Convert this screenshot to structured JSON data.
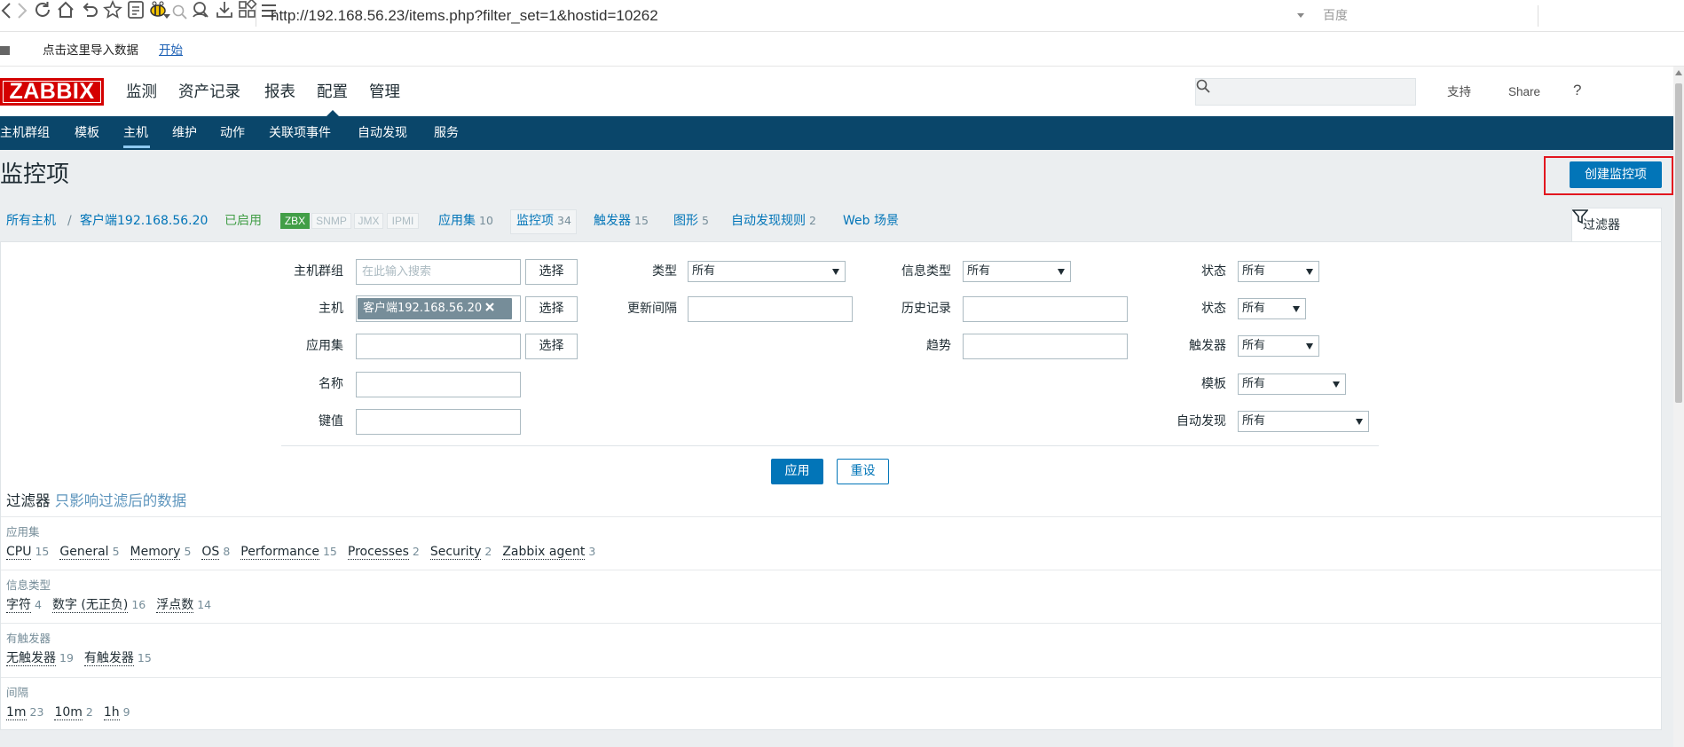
{
  "browser": {
    "url": "http://192.168.56.23/items.php?filter_set=1&hostid=10262",
    "search_engine": "百度"
  },
  "bookmarks": {
    "import_text": "点击这里导入数据",
    "start_link": "开始"
  },
  "header": {
    "logo": "ZABBIX",
    "nav": [
      {
        "label": "监测"
      },
      {
        "label": "资产记录"
      },
      {
        "label": "报表"
      },
      {
        "label": "配置",
        "active": true
      },
      {
        "label": "管理"
      }
    ],
    "support": "支持",
    "share": "Share",
    "help": "?"
  },
  "subnav": {
    "items": [
      "主机群组",
      "模板",
      "主机",
      "维护",
      "动作",
      "关联项事件",
      "自动发现",
      "服务"
    ],
    "active": "主机"
  },
  "page": {
    "title": "监控项",
    "create_button": "创建监控项"
  },
  "breadcrumb": {
    "all_hosts": "所有主机",
    "separator": "/",
    "host": "客户端192.168.56.20",
    "status": "已启用",
    "availability": [
      {
        "label": "ZBX",
        "state": "available"
      },
      {
        "label": "SNMP",
        "state": "unknown"
      },
      {
        "label": "JMX",
        "state": "unknown"
      },
      {
        "label": "IPMI",
        "state": "unknown"
      }
    ],
    "tabs": [
      {
        "label": "应用集",
        "count": "10"
      },
      {
        "label": "监控项",
        "count": "34",
        "active": true
      },
      {
        "label": "触发器",
        "count": "15"
      },
      {
        "label": "图形",
        "count": "5"
      },
      {
        "label": "自动发现规则",
        "count": "2"
      },
      {
        "label": "Web 场景"
      }
    ]
  },
  "filter": {
    "tab_label": "过滤器",
    "select_button": "选择",
    "apply_button": "应用",
    "reset_button": "重设",
    "fields": {
      "host_group": {
        "label": "主机群组",
        "placeholder": "在此输入搜索",
        "value": ""
      },
      "host": {
        "label": "主机",
        "tags": [
          "客户端192.168.56.20"
        ]
      },
      "application": {
        "label": "应用集",
        "value": ""
      },
      "name": {
        "label": "名称",
        "value": ""
      },
      "key": {
        "label": "键值",
        "value": ""
      },
      "type": {
        "label": "类型",
        "value": "所有"
      },
      "update_interval": {
        "label": "更新间隔",
        "value": ""
      },
      "value_type": {
        "label": "信息类型",
        "value": "所有"
      },
      "history": {
        "label": "历史记录",
        "value": ""
      },
      "trends": {
        "label": "趋势",
        "value": ""
      },
      "state": {
        "label": "状态",
        "value": "所有"
      },
      "status": {
        "label": "状态",
        "value": "所有"
      },
      "triggers": {
        "label": "触发器",
        "value": "所有"
      },
      "template": {
        "label": "模板",
        "value": "所有"
      },
      "discovery": {
        "label": "自动发现",
        "value": "所有"
      }
    }
  },
  "subfilter": {
    "title": "过滤器",
    "hint": "只影响过滤后的数据",
    "groups": [
      {
        "label": "应用集",
        "items": [
          {
            "name": "CPU",
            "count": "15"
          },
          {
            "name": "General",
            "count": "5"
          },
          {
            "name": "Memory",
            "count": "5"
          },
          {
            "name": "OS",
            "count": "8"
          },
          {
            "name": "Performance",
            "count": "15"
          },
          {
            "name": "Processes",
            "count": "2"
          },
          {
            "name": "Security",
            "count": "2"
          },
          {
            "name": "Zabbix agent",
            "count": "3"
          }
        ]
      },
      {
        "label": "信息类型",
        "items": [
          {
            "name": "字符",
            "count": "4"
          },
          {
            "name": "数字 (无正负)",
            "count": "16"
          },
          {
            "name": "浮点数",
            "count": "14"
          }
        ]
      },
      {
        "label": "有触发器",
        "items": [
          {
            "name": "无触发器",
            "count": "19"
          },
          {
            "name": "有触发器",
            "count": "15"
          }
        ]
      },
      {
        "label": "间隔",
        "items": [
          {
            "name": "1m",
            "count": "23"
          },
          {
            "name": "10m",
            "count": "2"
          },
          {
            "name": "1h",
            "count": "9"
          }
        ]
      }
    ]
  },
  "colors": {
    "brand_red": "#d40000",
    "nav_bar": "#0a466a",
    "primary": "#0275b8",
    "enabled_green": "#429e47",
    "muted": "#768d99",
    "highlight_box": "#e2161f"
  },
  "icons": {
    "filter_tab": "funnel-icon",
    "search": "search-icon",
    "support": "headset-icon",
    "share": "share-logo-icon",
    "user": "user-icon",
    "logout": "power-icon",
    "tag_remove": "close-icon"
  }
}
